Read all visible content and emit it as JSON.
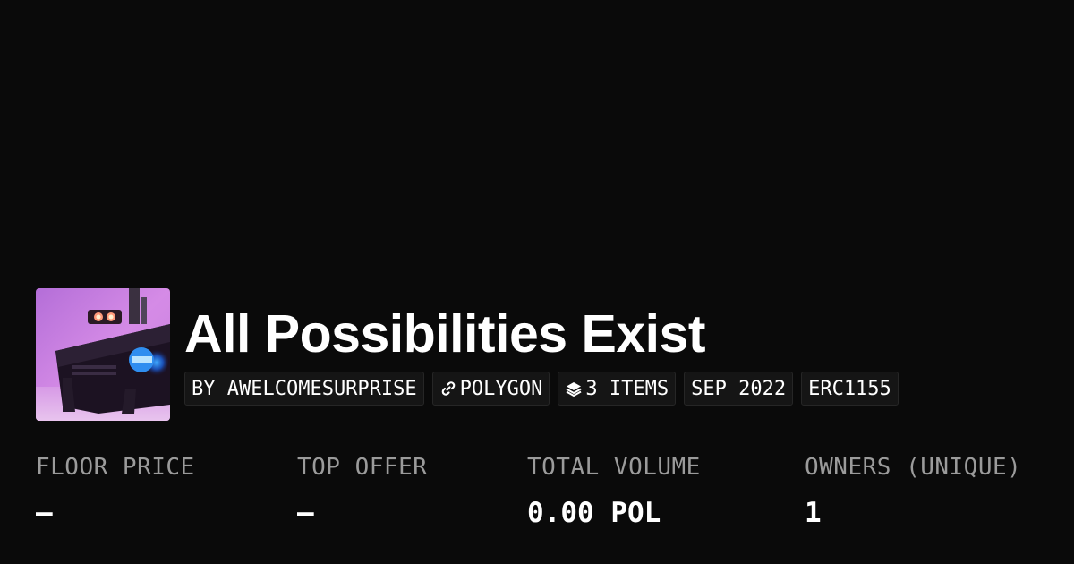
{
  "collection": {
    "title": "All Possibilities Exist",
    "image": "collection-thumbnail"
  },
  "tags": {
    "creator": "BY AWELCOMESURPRISE",
    "chain": "POLYGON",
    "chain_icon": "link-icon",
    "items": "3 ITEMS",
    "items_icon": "layers-icon",
    "date": "SEP 2022",
    "standard": "ERC1155"
  },
  "stats": {
    "floor_label": "FLOOR PRICE",
    "floor_value": "–",
    "offer_label": "TOP OFFER",
    "offer_value": "–",
    "volume_label": "TOTAL VOLUME",
    "volume_value": "0.00 POL",
    "owners_label": "OWNERS (UNIQUE)",
    "owners_value": "1"
  },
  "colors": {
    "background": "#0a0a0a",
    "text": "#ffffff",
    "muted": "#9b9b9b",
    "tag_bg": "#151515"
  }
}
